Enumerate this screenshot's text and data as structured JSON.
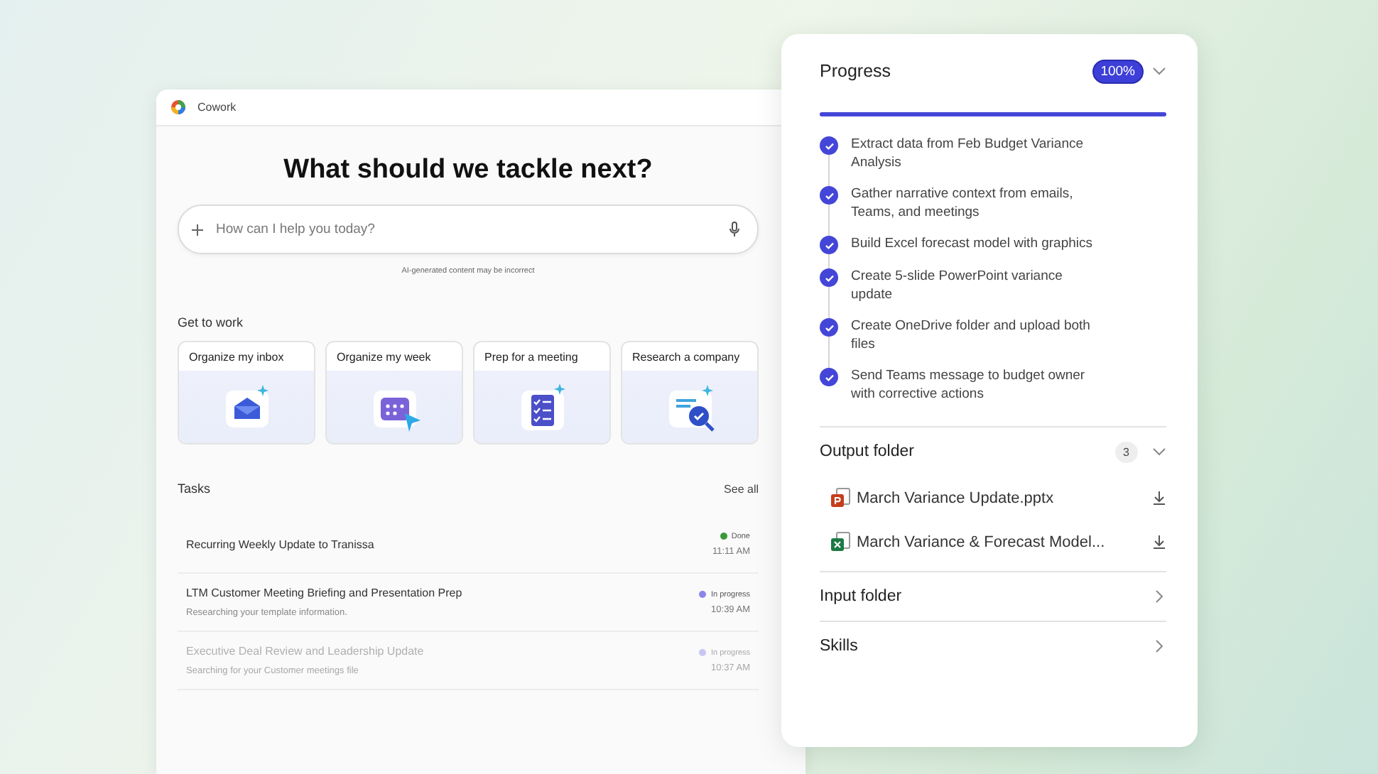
{
  "app": {
    "title": "Cowork"
  },
  "heading": "What should we tackle next?",
  "search": {
    "placeholder": "How can I help you today?"
  },
  "disclaimer": "AI-generated content may be incorrect",
  "get_to_work": {
    "title": "Get to work",
    "cards": [
      {
        "label": "Organize my inbox",
        "kind": "inbox"
      },
      {
        "label": "Organize my week",
        "kind": "calendar"
      },
      {
        "label": "Prep for a meeting",
        "kind": "checklist"
      },
      {
        "label": "Research a company",
        "kind": "research"
      }
    ]
  },
  "tasks": {
    "title": "Tasks",
    "link": "See all",
    "rows": [
      {
        "title": "Recurring Weekly Update to Tranissa",
        "status": "Done",
        "color": "#3a9a3a",
        "time": "11:11 AM"
      },
      {
        "title": "LTM Customer Meeting Briefing and Presentation Prep",
        "subtitle": "Researching your template information.",
        "status": "In progress",
        "color": "#8a86e8",
        "time": "10:39 AM"
      },
      {
        "title": "Executive Deal Review and Leadership Update",
        "subtitle": "Searching for your Customer meetings file",
        "status": "In progress",
        "color": "#c9c6f3",
        "time": "10:37 AM"
      }
    ]
  },
  "progress": {
    "title": "Progress",
    "badge": "100%",
    "level": 1,
    "expanded": true,
    "steps": [
      {
        "text": "Extract data from Feb Budget Variance Analysis",
        "done": true
      },
      {
        "text": "Gather narrative context from emails, Teams, and meetings",
        "done": true
      },
      {
        "text": "Build Excel forecast model with graphics",
        "done": true
      },
      {
        "text": "Create 5-slide PowerPoint variance update",
        "done": true
      },
      {
        "text": "Create OneDrive folder and upload both files",
        "done": true
      },
      {
        "text": "Send Teams message to budget owner with corrective actions",
        "done": true
      }
    ]
  },
  "sections": [
    {
      "title": "Output folder",
      "count": "3",
      "expanded": true,
      "files": [
        {
          "name": "March Variance Update.pptx",
          "kind": "powerpoint"
        },
        {
          "name": "March Variance & Forecast Model...",
          "kind": "excel"
        }
      ]
    },
    {
      "title": "Input folder",
      "expanded": false
    },
    {
      "title": "Skills",
      "expanded": false
    }
  ]
}
